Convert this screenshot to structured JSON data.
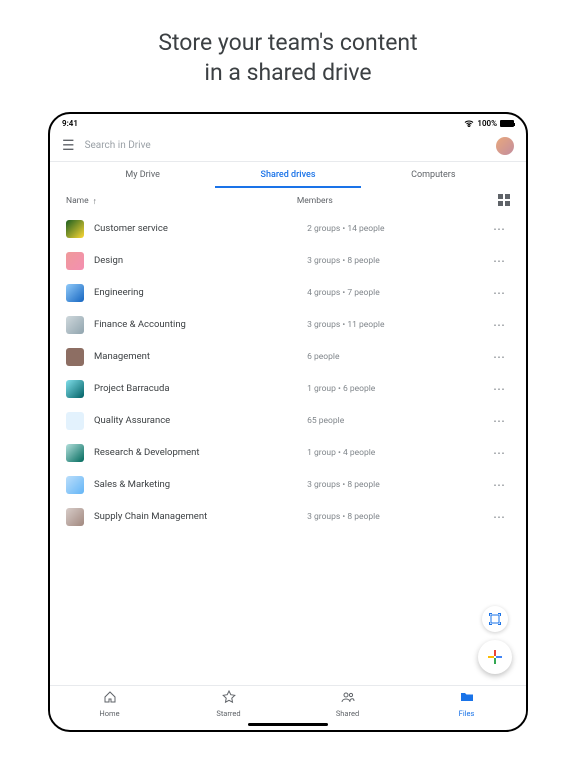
{
  "headline_line1": "Store your team's content",
  "headline_line2": "in a shared drive",
  "status": {
    "time": "9:41",
    "battery": "100%"
  },
  "search": {
    "placeholder": "Search in Drive"
  },
  "tabs": {
    "my_drive": "My Drive",
    "shared_drives": "Shared drives",
    "computers": "Computers"
  },
  "columns": {
    "name": "Name",
    "members": "Members"
  },
  "drives": [
    {
      "name": "Customer service",
      "members": "2 groups • 14 people",
      "thumb": "t0"
    },
    {
      "name": "Design",
      "members": "3 groups • 8 people",
      "thumb": "t1"
    },
    {
      "name": "Engineering",
      "members": "4 groups • 7 people",
      "thumb": "t2"
    },
    {
      "name": "Finance & Accounting",
      "members": "3 groups • 11 people",
      "thumb": "t3"
    },
    {
      "name": "Management",
      "members": "6 people",
      "thumb": "t4"
    },
    {
      "name": "Project Barracuda",
      "members": "1 group • 6 people",
      "thumb": "t5"
    },
    {
      "name": "Quality Assurance",
      "members": "65 people",
      "thumb": "t6"
    },
    {
      "name": "Research & Development",
      "members": "1 group • 4 people",
      "thumb": "t7"
    },
    {
      "name": "Sales & Marketing",
      "members": "3 groups • 8 people",
      "thumb": "t8"
    },
    {
      "name": "Supply Chain Management",
      "members": "3 groups • 8 people",
      "thumb": "t9"
    }
  ],
  "nav": {
    "home": "Home",
    "starred": "Starred",
    "shared": "Shared",
    "files": "Files"
  }
}
